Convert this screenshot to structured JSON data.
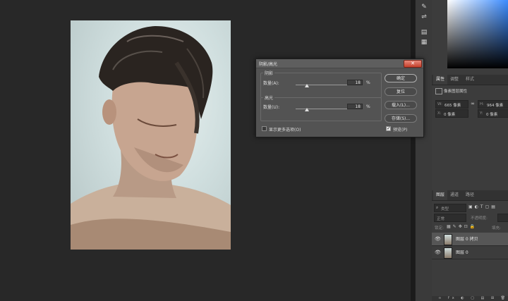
{
  "toolstrip": {
    "icons": [
      "brush-settings-icon",
      "adjustments-icon",
      "properties-icon",
      "notes-icon"
    ]
  },
  "properties_panel": {
    "tabs": [
      "属性",
      "调整",
      "样式"
    ],
    "layer_label": "像素图层属性",
    "w_label": "W:",
    "w_value": "665 像素",
    "h_label": "H:",
    "h_value": "964 像素",
    "x_label": "X:",
    "x_value": "0 像素",
    "y_label": "Y:",
    "y_value": "0 像素"
  },
  "layers_panel": {
    "tabs": [
      "图层",
      "通道",
      "路径"
    ],
    "search_placeholder": "类型",
    "blend_mode": "正常",
    "opacity_label": "不透明度:",
    "lock_label": "锁定:",
    "fill_label": "填充:",
    "layers": [
      {
        "name": "图层 0 拷贝",
        "selected": true
      },
      {
        "name": "图层 0",
        "selected": false
      }
    ]
  },
  "dialog": {
    "title": "阴影/高光",
    "close_symbol": "✕",
    "shadows_group": "阴影",
    "highlights_group": "高光",
    "shadow_amount_label": "数量(A):",
    "shadow_amount_value": "18",
    "shadow_amount_fraction": 0.18,
    "highlight_amount_label": "数量(U):",
    "highlight_amount_value": "18",
    "highlight_amount_fraction": 0.18,
    "percent_unit": "%",
    "buttons": {
      "ok": "确定",
      "reset": "复位",
      "load": "载入(L)...",
      "save": "存储(S)..."
    },
    "more_options_label": "显示更多选项(O)",
    "more_options_checked": false,
    "preview_label": "预览(P)",
    "preview_checked": true
  }
}
